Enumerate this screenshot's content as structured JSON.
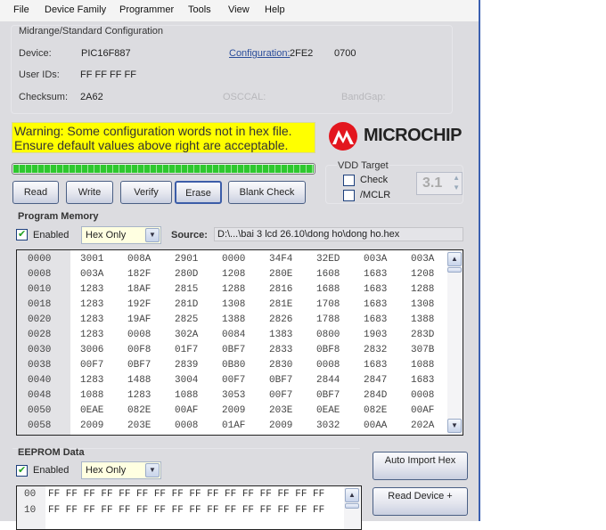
{
  "menu": [
    "File",
    "Device Family",
    "Programmer",
    "Tools",
    "View",
    "Help"
  ],
  "config": {
    "title": "Midrange/Standard Configuration",
    "device_label": "Device:",
    "device": "PIC16F887",
    "userids_label": "User IDs:",
    "userids": "FF FF FF FF",
    "checksum_label": "Checksum:",
    "checksum": "2A62",
    "configuration_label": "Configuration:",
    "config_words": [
      "2FE2",
      "0700"
    ],
    "osccal_label": "OSCCAL:",
    "bandgap_label": "BandGap:"
  },
  "warning": [
    "Warning: Some configuration words not in hex file.",
    "Ensure default values above right are acceptable."
  ],
  "logo_text": "MICROCHIP",
  "progress": 1.0,
  "buttons": {
    "read": "Read",
    "write": "Write",
    "verify": "Verify",
    "erase": "Erase",
    "blank_check": "Blank Check",
    "auto_import": "Auto Import Hex",
    "read_device": "Read Device +"
  },
  "vdd": {
    "title": "VDD Target",
    "check": "Check",
    "mclr": "/MCLR",
    "value": "3.1"
  },
  "program_memory": {
    "title": "Program Memory",
    "enabled": "Enabled",
    "mode": "Hex Only",
    "source_label": "Source:",
    "source": "D:\\...\\bai 3 lcd 26.10\\dong ho\\dong ho.hex",
    "rows": [
      [
        "0000",
        "3001",
        "008A",
        "2901",
        "0000",
        "34F4",
        "32ED",
        "003A",
        "003A"
      ],
      [
        "0008",
        "003A",
        "182F",
        "280D",
        "1208",
        "280E",
        "1608",
        "1683",
        "1208"
      ],
      [
        "0010",
        "1283",
        "18AF",
        "2815",
        "1288",
        "2816",
        "1688",
        "1683",
        "1288"
      ],
      [
        "0018",
        "1283",
        "192F",
        "281D",
        "1308",
        "281E",
        "1708",
        "1683",
        "1308"
      ],
      [
        "0020",
        "1283",
        "19AF",
        "2825",
        "1388",
        "2826",
        "1788",
        "1683",
        "1388"
      ],
      [
        "0028",
        "1283",
        "0008",
        "302A",
        "0084",
        "1383",
        "0800",
        "1903",
        "283D"
      ],
      [
        "0030",
        "3006",
        "00F8",
        "01F7",
        "0BF7",
        "2833",
        "0BF8",
        "2832",
        "307B"
      ],
      [
        "0038",
        "00F7",
        "0BF7",
        "2839",
        "0B80",
        "2830",
        "0008",
        "1683",
        "1088"
      ],
      [
        "0040",
        "1283",
        "1488",
        "3004",
        "00F7",
        "0BF7",
        "2844",
        "2847",
        "1683"
      ],
      [
        "0048",
        "1088",
        "1283",
        "1088",
        "3053",
        "00F7",
        "0BF7",
        "284D",
        "0008"
      ],
      [
        "0050",
        "0EAE",
        "082E",
        "00AF",
        "2009",
        "203E",
        "0EAE",
        "082E",
        "00AF"
      ],
      [
        "0058",
        "2009",
        "203E",
        "0008",
        "01AF",
        "2009",
        "3032",
        "00AA",
        "202A"
      ]
    ]
  },
  "eeprom": {
    "title": "EEPROM Data",
    "enabled": "Enabled",
    "mode": "Hex Only",
    "rows": [
      [
        "00",
        "FF FF FF FF FF FF FF FF FF FF FF FF FF FF FF FF"
      ],
      [
        "10",
        "FF FF FF FF FF FF FF FF FF FF FF FF FF FF FF FF"
      ]
    ]
  }
}
